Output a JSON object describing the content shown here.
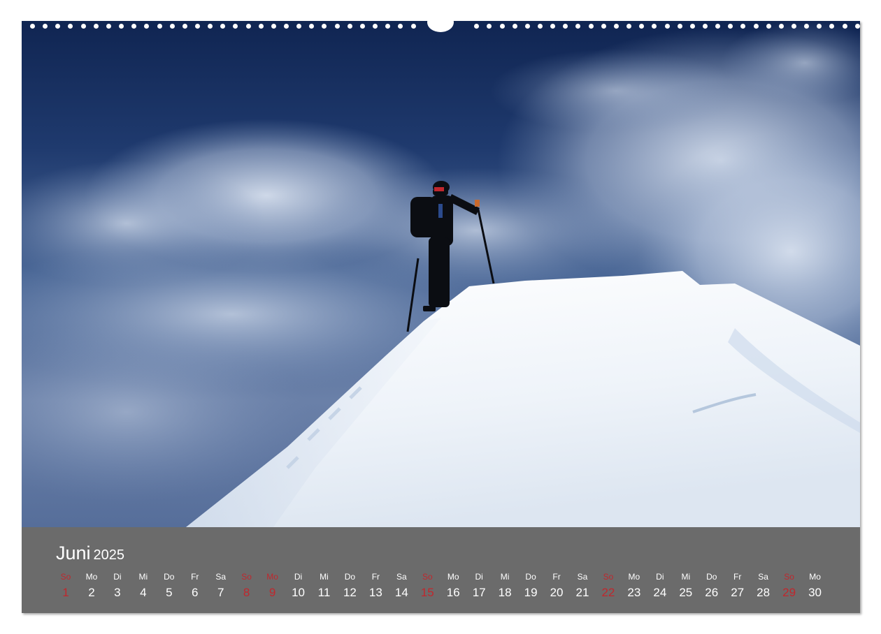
{
  "calendar": {
    "month": "Juni",
    "year": "2025",
    "days": [
      {
        "name": "So",
        "num": "1",
        "holiday": true
      },
      {
        "name": "Mo",
        "num": "2",
        "holiday": false
      },
      {
        "name": "Di",
        "num": "3",
        "holiday": false
      },
      {
        "name": "Mi",
        "num": "4",
        "holiday": false
      },
      {
        "name": "Do",
        "num": "5",
        "holiday": false
      },
      {
        "name": "Fr",
        "num": "6",
        "holiday": false
      },
      {
        "name": "Sa",
        "num": "7",
        "holiday": false
      },
      {
        "name": "So",
        "num": "8",
        "holiday": true
      },
      {
        "name": "Mo",
        "num": "9",
        "holiday": true
      },
      {
        "name": "Di",
        "num": "10",
        "holiday": false
      },
      {
        "name": "Mi",
        "num": "11",
        "holiday": false
      },
      {
        "name": "Do",
        "num": "12",
        "holiday": false
      },
      {
        "name": "Fr",
        "num": "13",
        "holiday": false
      },
      {
        "name": "Sa",
        "num": "14",
        "holiday": false
      },
      {
        "name": "So",
        "num": "15",
        "holiday": true
      },
      {
        "name": "Mo",
        "num": "16",
        "holiday": false
      },
      {
        "name": "Di",
        "num": "17",
        "holiday": false
      },
      {
        "name": "Mi",
        "num": "18",
        "holiday": false
      },
      {
        "name": "Do",
        "num": "19",
        "holiday": false
      },
      {
        "name": "Fr",
        "num": "20",
        "holiday": false
      },
      {
        "name": "Sa",
        "num": "21",
        "holiday": false
      },
      {
        "name": "So",
        "num": "22",
        "holiday": true
      },
      {
        "name": "Mo",
        "num": "23",
        "holiday": false
      },
      {
        "name": "Di",
        "num": "24",
        "holiday": false
      },
      {
        "name": "Mi",
        "num": "25",
        "holiday": false
      },
      {
        "name": "Do",
        "num": "26",
        "holiday": false
      },
      {
        "name": "Fr",
        "num": "27",
        "holiday": false
      },
      {
        "name": "Sa",
        "num": "28",
        "holiday": false
      },
      {
        "name": "So",
        "num": "29",
        "holiday": true
      },
      {
        "name": "Mo",
        "num": "30",
        "holiday": false
      }
    ]
  },
  "colors": {
    "bar_background": "#6b6b6b",
    "holiday_red": "#c0272d",
    "text_white": "#ffffff",
    "sky_dark": "#142a57",
    "snow": "#f4f7fb"
  }
}
